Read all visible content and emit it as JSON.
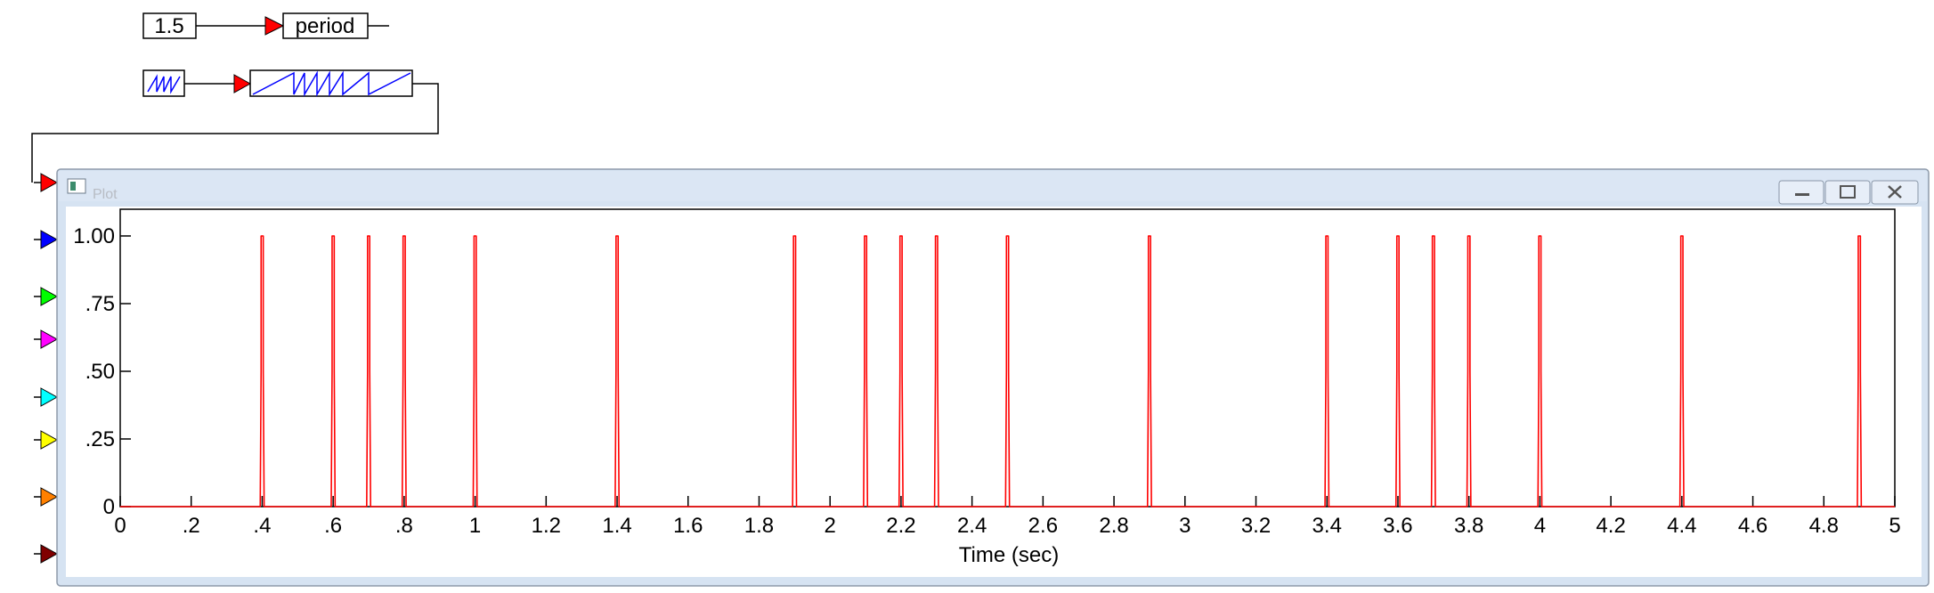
{
  "diagram": {
    "constant_block": {
      "value": "1.5"
    },
    "period_block": {
      "label": "period"
    },
    "sawtooth_source_icon": "sawtooth-wave-icon",
    "waveform_icon": "sawtooth-waveform-icon",
    "connector_color": "#ff0000",
    "wire_color": "#000000"
  },
  "input_ports": [
    {
      "name": "port-1",
      "color": "#ff0000"
    },
    {
      "name": "port-2",
      "color": "#0000ff"
    },
    {
      "name": "port-3",
      "color": "#00ff00"
    },
    {
      "name": "port-4",
      "color": "#ff00ff"
    },
    {
      "name": "port-5",
      "color": "#00ffff"
    },
    {
      "name": "port-6",
      "color": "#ffff00"
    },
    {
      "name": "port-7",
      "color": "#ff8000"
    },
    {
      "name": "port-8",
      "color": "#800000"
    }
  ],
  "plot_window": {
    "title": "Plot",
    "buttons": [
      "minimize",
      "maximize",
      "close"
    ]
  },
  "chart_data": {
    "type": "line",
    "xlabel": "Time (sec)",
    "ylabel": "",
    "xlim": [
      0,
      5
    ],
    "ylim": [
      0,
      1
    ],
    "x_ticks": [
      "0",
      ".2",
      ".4",
      ".6",
      ".8",
      "1",
      "1.2",
      "1.4",
      "1.6",
      "1.8",
      "2",
      "2.2",
      "2.4",
      "2.6",
      "2.8",
      "3",
      "3.2",
      "3.4",
      "3.6",
      "3.8",
      "4",
      "4.2",
      "4.4",
      "4.6",
      "4.8",
      "5"
    ],
    "y_ticks": [
      "0",
      ".25",
      ".50",
      ".75",
      "1.00"
    ],
    "grid": false,
    "series": [
      {
        "color": "#ff0000",
        "pulse_times": [
          0.4,
          0.6,
          0.7,
          0.8,
          1.0,
          1.4,
          1.9,
          2.1,
          2.2,
          2.3,
          2.5,
          2.9,
          3.4,
          3.6,
          3.7,
          3.8,
          4.0,
          4.4,
          4.9
        ],
        "pulse_height": 1.0
      }
    ]
  }
}
